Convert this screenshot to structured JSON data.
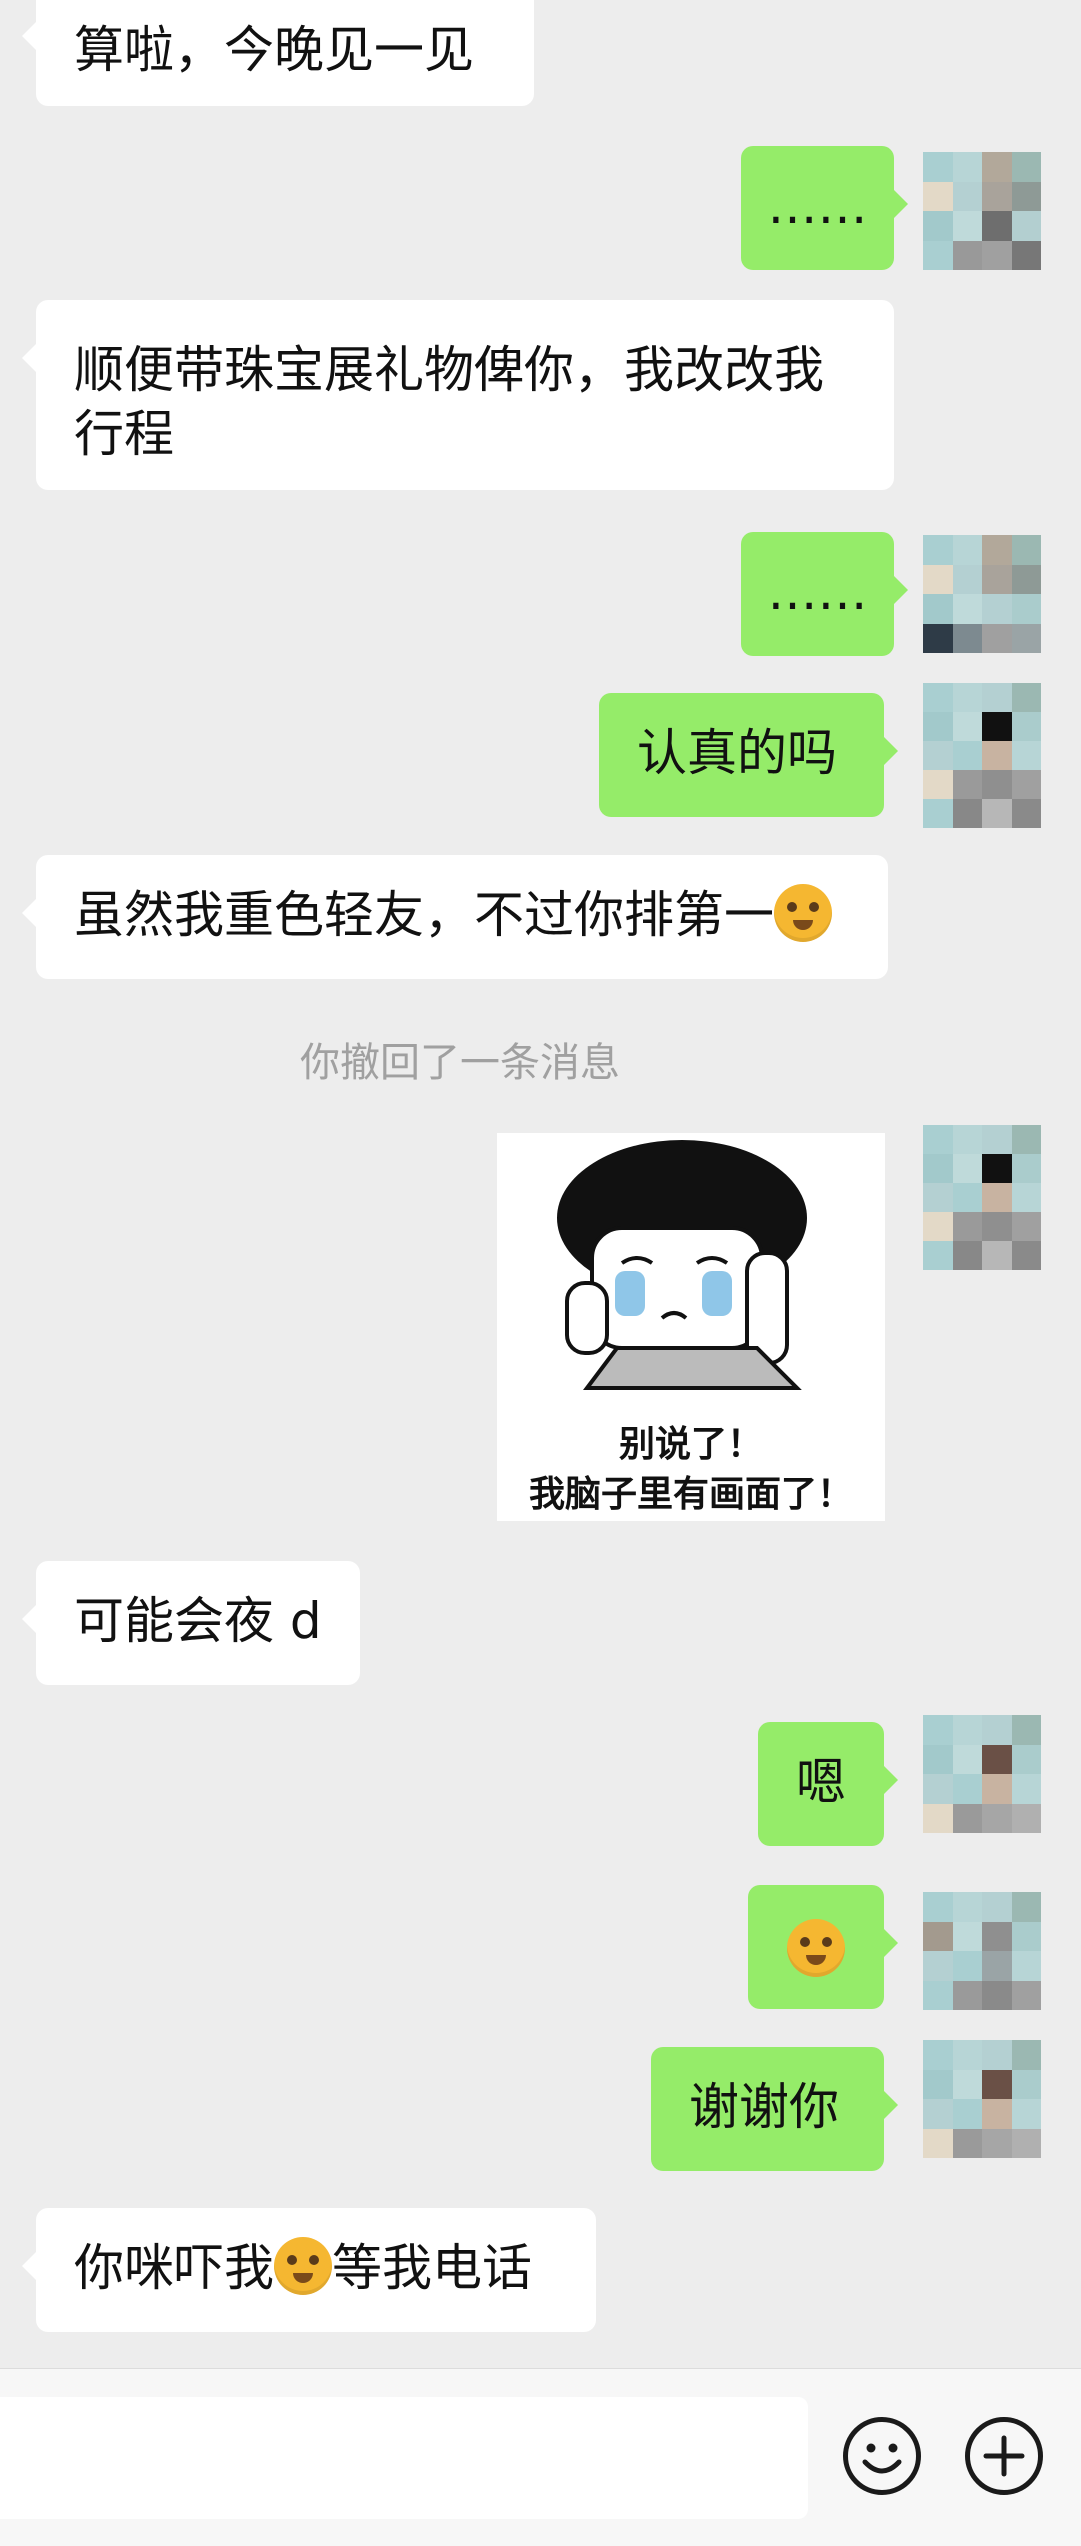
{
  "messages": [
    {
      "side": "in",
      "text": "算啦，今晚见一见"
    },
    {
      "side": "out",
      "text": "……"
    },
    {
      "side": "in",
      "text": "顺便带珠宝展礼物俾你，我改改我行程"
    },
    {
      "side": "out",
      "text": "……"
    },
    {
      "side": "out",
      "text": "认真的吗"
    },
    {
      "side": "in",
      "text": "虽然我重色轻友，不过你排第一",
      "emoji": "smirk-face-emoji"
    },
    {
      "side": "system",
      "text": "你撤回了一条消息"
    },
    {
      "side": "out",
      "type": "sticker",
      "caption_line1": "别说了！",
      "caption_line2": "我脑子里有画面了！"
    },
    {
      "side": "in",
      "text": "可能会夜 d"
    },
    {
      "side": "out",
      "text": "嗯"
    },
    {
      "side": "out",
      "emoji": "crying-face-emoji"
    },
    {
      "side": "out",
      "text": "谢谢你"
    },
    {
      "side": "in",
      "text_before": "你咪吓我",
      "emoji": "flushed-face-emoji",
      "text_after": "等我电话"
    }
  ],
  "input_bar": {
    "emoji_button_icon": "smiley-icon",
    "more_button_icon": "plus-icon"
  },
  "colors": {
    "background": "#ededed",
    "incoming_bubble": "#ffffff",
    "outgoing_bubble": "#95ec69",
    "system_text": "#a0a0a0"
  }
}
